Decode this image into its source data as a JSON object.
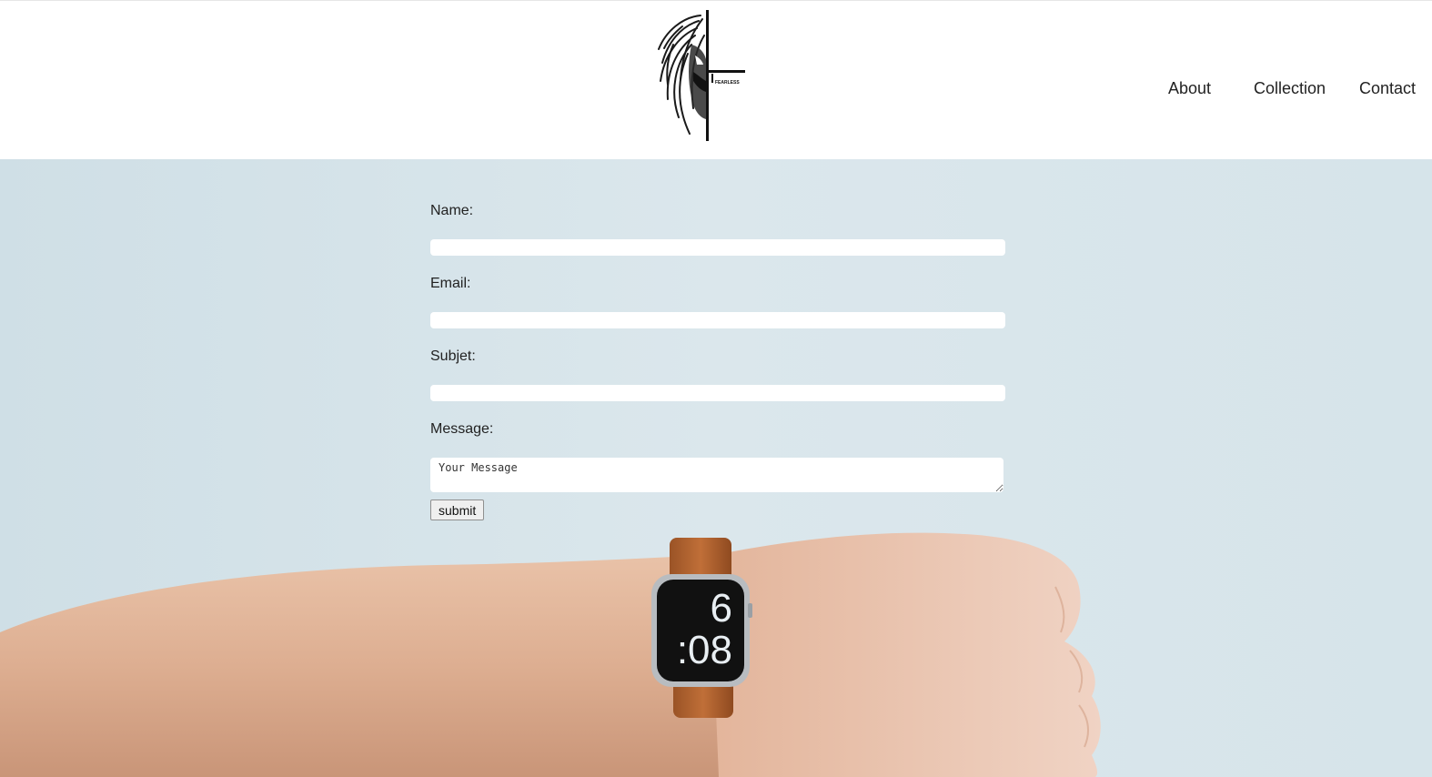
{
  "nav": {
    "items": [
      {
        "id": "about",
        "label": "About"
      },
      {
        "id": "collection",
        "label": "Collection"
      },
      {
        "id": "contact",
        "label": "Contact"
      }
    ]
  },
  "logo": {
    "icon": "lion-logo-icon",
    "wordmark": "FEARLESS"
  },
  "form": {
    "name_label": "Name:",
    "email_label": "Email:",
    "subject_label": "Subjet:",
    "message_label": "Message:",
    "message_placeholder": "Your Message",
    "submit_label": "submit"
  },
  "watch": {
    "hour": "6",
    "minutes": ":08"
  },
  "colors": {
    "hero_background": "#d6e4ea",
    "skin": "#e6b79d",
    "watch_strap": "#b5642f",
    "watch_face": "#111111",
    "watch_digits": "#e8eef2"
  }
}
